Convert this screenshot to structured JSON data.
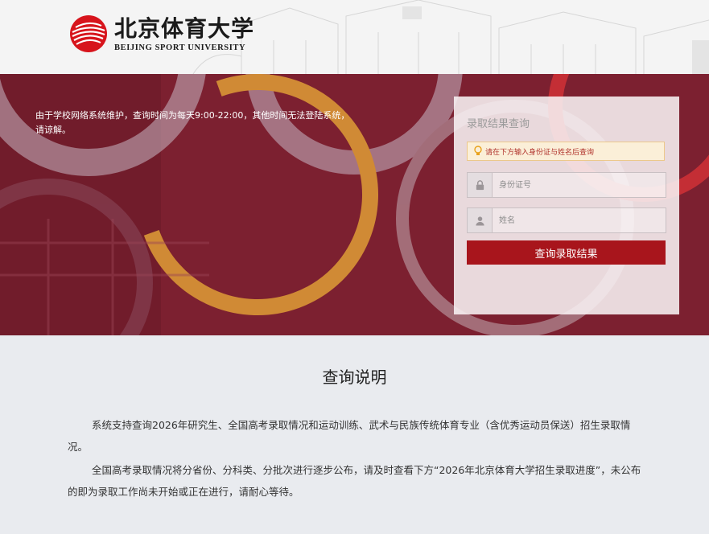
{
  "header": {
    "logo_cn": "北京体育大学",
    "logo_en": "BEIJING SPORT UNIVERSITY"
  },
  "banner": {
    "notice": "由于学校网络系统维护，查询时间为每天9:00-22:00，其他时间无法登陆系统，请谅解。"
  },
  "query_panel": {
    "title": "录取结果查询",
    "tip": "请在下方输入身份证与姓名后查询",
    "id_placeholder": "身份证号",
    "name_placeholder": "姓名",
    "submit_label": "查询录取结果"
  },
  "instructions": {
    "title": "查询说明",
    "paragraph_1": "系统支持查询2026年研究生、全国高考录取情况和运动训练、武术与民族传统体育专业（含优秀运动员保送）招生录取情况。",
    "paragraph_2": "全国高考录取情况将分省份、分科类、分批次进行逐步公布，请及时查看下方“2026年北京体育大学招生录取进度”，未公布的即为录取工作尚未开始或正在进行，请耐心等待。"
  },
  "colors": {
    "brand_red": "#a8151c",
    "banner_bg": "#7a1f2b"
  }
}
